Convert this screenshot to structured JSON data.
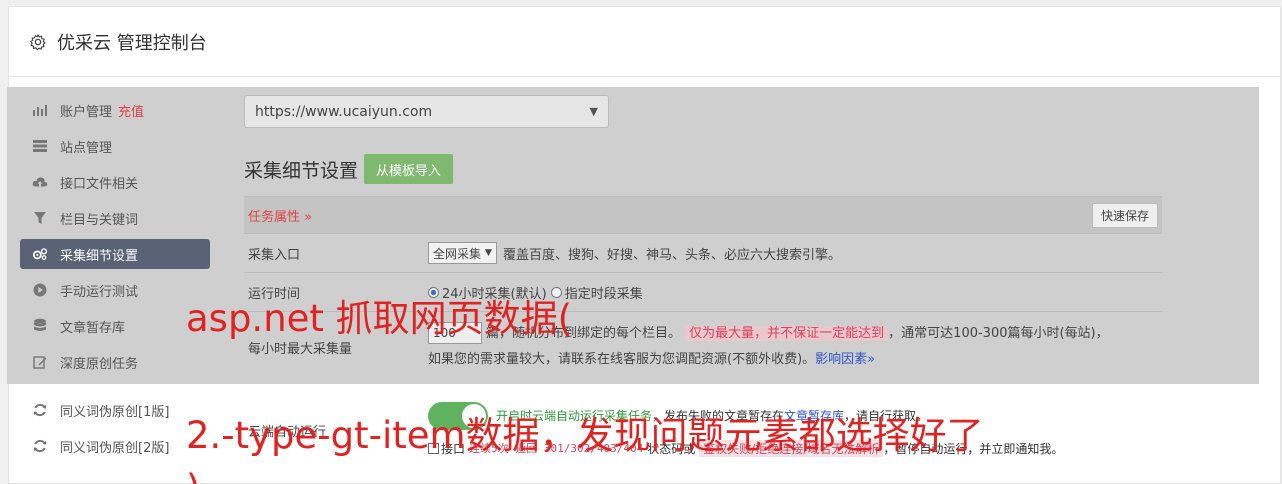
{
  "header": {
    "title": "优采云 管理控制台"
  },
  "sidebar": {
    "items": [
      {
        "label": "账户管理",
        "extra": "充值"
      },
      {
        "label": "站点管理"
      },
      {
        "label": "接口文件相关"
      },
      {
        "label": "栏目与关键词"
      },
      {
        "label": "采集细节设置"
      },
      {
        "label": "手动运行测试"
      },
      {
        "label": "文章暂存库"
      },
      {
        "label": "深度原创任务"
      },
      {
        "label": "同义词伪原创[1版]"
      },
      {
        "label": "同义词伪原创[2版]"
      }
    ]
  },
  "main": {
    "site_select": "https://www.ucaiyun.com",
    "section_title": "采集细节设置",
    "import_button": "从模板导入",
    "table": {
      "head_attr": "任务属性 »",
      "save_button": "快速保存",
      "row1": {
        "label": "采集入口",
        "select": "全网采集",
        "desc": "覆盖百度、搜狗、好搜、神马、头条、必应六大搜索引擎。"
      },
      "row2": {
        "label": "运行时间",
        "opt1": "24小时采集(默认)",
        "opt2": "指定时段采集"
      },
      "row3": {
        "label": "每小时最大采集量",
        "input": "100",
        "text1": "篇，随机分布到绑定的每个栏目。",
        "pink": "仅为最大量，并不保证一定能达到",
        "text2": "，通常可达100-300篇每小时(每站)，",
        "text3": "如果您的需求量较大，请联系在线客服为您调配资源(不额外收费)。",
        "link": "影响因素»"
      },
      "row4": {
        "label": "云端自动运行",
        "green": "开启时云端自动运行采集任务",
        "text1": "，发布失败的文章暂存在",
        "link": "文章暂存库",
        "text2": "，请自行获取。",
        "check": "接口",
        "red1": "连续5次 返回 301/302/403/404",
        "text3": "状态码或",
        "pink": "鉴权失败/拒绝连接/域名无法解析",
        "text4": "，暂停自动运行，并立即通知我。"
      }
    }
  },
  "overlay": {
    "line1": "asp.net 抓取网页数据(",
    "line2": "2.-type-gt-item数据，发现问题元素都选择好了",
    "line3": ")"
  }
}
